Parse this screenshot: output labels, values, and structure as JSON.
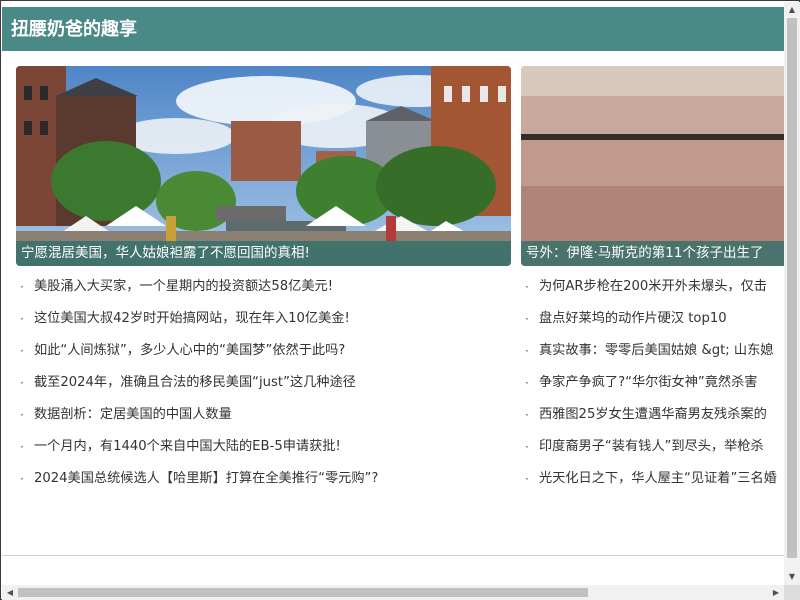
{
  "header": {
    "title": "扭腰奶爸的趣享"
  },
  "cards": [
    {
      "caption": "宁愿混居美国，华人姑娘袒露了不愿回国的真相!"
    },
    {
      "caption": "号外：伊隆·马斯克的第11个孩子出生了"
    }
  ],
  "list_left": [
    "美股涌入大买家，一个星期内的投资额达58亿美元!",
    "这位美国大叔42岁时开始搞网站，现在年入10亿美金!",
    "如此“人间炼狱”，多少人心中的“美国梦”依然于此吗?",
    "截至2024年，准确且合法的移民美国“just”这几种途径",
    "数据剖析：定居美国的中国人数量",
    "一个月内，有1440个来自中国大陆的EB-5申请获批!",
    "2024美国总统候选人【哈里斯】打算在全美推行“零元购”?"
  ],
  "list_right": [
    "为何AR步枪在200米开外未爆头，仅击",
    "盘点好莱坞的动作片硬汉 top10",
    "真实故事：零零后美国姑娘 &gt; 山东媳",
    "争家产争疯了?“华尔街女神”竟然杀害",
    "西雅图25岁女生遭遇华裔男友残杀案的",
    "印度裔男子“装有钱人”到尽头，举枪杀",
    "光天化日之下，华人屋主“见证着”三名婚"
  ],
  "bullet": "·",
  "scrollbar": {
    "up": "▲",
    "down": "▼",
    "left": "◀",
    "right": "▶"
  },
  "colors": {
    "header_bg": "#4a8a86",
    "caption_bg": "#2d6e6c"
  }
}
